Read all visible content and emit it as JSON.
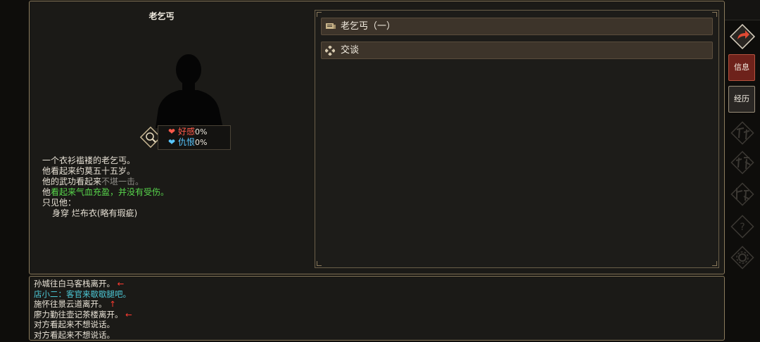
{
  "npc": {
    "name": "老乞丐",
    "relations": [
      {
        "label": "好感",
        "value": "0%",
        "color": "#ff5a4a"
      },
      {
        "label": "仇恨",
        "value": "0%",
        "color": "#58c6ff"
      }
    ]
  },
  "description": {
    "line1": "一个衣衫褴褛的老乞丐。",
    "line2": "他看起来约莫五十五岁。",
    "line3_prefix": "他的武功看起来",
    "line3_value": "不堪一击。",
    "line4_prefix": "他",
    "line4_value": "看起来气血充盈，并没有受伤。",
    "line5": "只见他：",
    "line6": "身穿 烂布衣(略有瑕疵)"
  },
  "options": [
    {
      "label": "老乞丐（一）",
      "icon": "scroll-icon"
    },
    {
      "label": "交谈",
      "icon": "diamond-cluster-icon"
    }
  ],
  "log": [
    {
      "text": "孙城往白马客栈离开。",
      "arrow": "←",
      "color": "#f0ebe0"
    },
    {
      "text": "店小二：客官来歇歇腿吧。",
      "arrow": "",
      "color": "#4cc8d6"
    },
    {
      "text": "施怀往景云道离开。",
      "arrow": "↑",
      "color": "#f0ebe0"
    },
    {
      "text": "廖力勤往壶记茶楼离开。",
      "arrow": "←",
      "color": "#f0ebe0"
    },
    {
      "text": "对方看起来不想说话。",
      "arrow": "",
      "color": "#f0ebe0"
    },
    {
      "text": "对方看起来不想说话。",
      "arrow": "",
      "color": "#f0ebe0"
    }
  ],
  "sidebar": {
    "info_label": "信息",
    "history_label": "经历",
    "disabled_items": [
      "工作",
      "武学",
      "门派",
      "help",
      "settings"
    ]
  }
}
